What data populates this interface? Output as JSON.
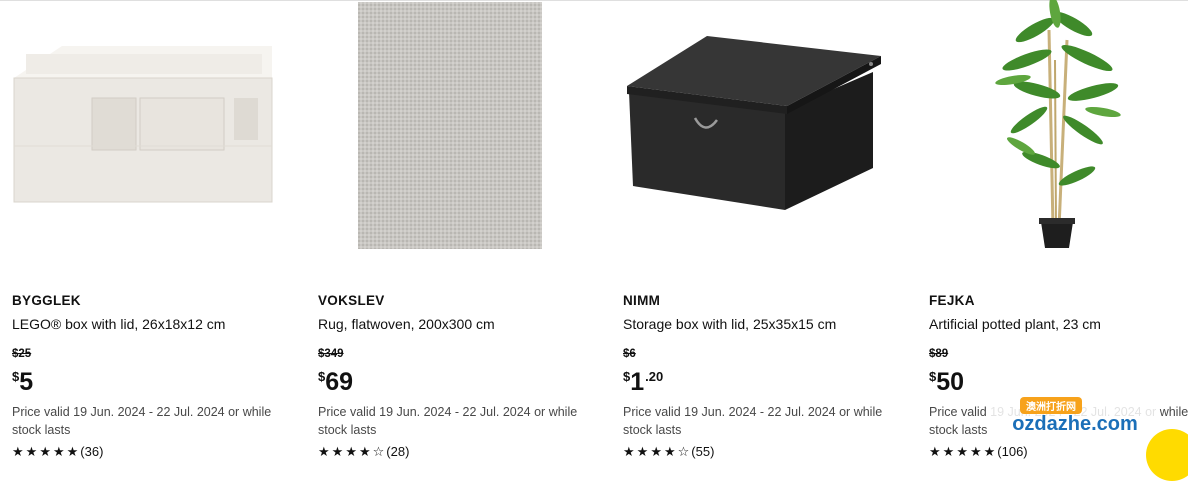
{
  "products": [
    {
      "name": "BYGGLEK",
      "description": "LEGO® box with lid, 26x18x12 cm",
      "old_price": "$25",
      "currency": "$",
      "price_int": "5",
      "price_dec": "",
      "validity": "Price valid 19 Jun. 2024 - 22 Jul. 2024 or while stock lasts",
      "reviews": "(36)",
      "image_icon": "lego-box-icon"
    },
    {
      "name": "VOKSLEV",
      "description": "Rug, flatwoven, 200x300 cm",
      "old_price": "$349",
      "currency": "$",
      "price_int": "69",
      "price_dec": "",
      "validity": "Price valid 19 Jun. 2024 - 22 Jul. 2024 or while stock lasts",
      "reviews": "(28)",
      "image_icon": "rug-icon"
    },
    {
      "name": "NIMM",
      "description": "Storage box with lid, 25x35x15 cm",
      "old_price": "$6",
      "currency": "$",
      "price_int": "1",
      "price_dec": ".20",
      "validity": "Price valid 19 Jun. 2024 - 22 Jul. 2024 or while stock lasts",
      "reviews": "(55)",
      "image_icon": "black-storage-box-icon"
    },
    {
      "name": "FEJKA",
      "description": "Artificial potted plant, 23 cm",
      "old_price": "$89",
      "currency": "$",
      "price_int": "50",
      "price_dec": "",
      "validity": "Price valid 19 Jun. 2024 - 22 Jul. 2024 or while stock lasts",
      "reviews": "(106)",
      "image_icon": "bamboo-plant-icon"
    }
  ],
  "watermark": {
    "text": "ozdazhe.com",
    "sub": "澳洲打折网"
  },
  "colors": {
    "box_black": "#2b2b2b",
    "rug_grey": "#c6c4c0",
    "lego_white": "#f2f0ec",
    "plant_green": "#3f8a2a"
  }
}
